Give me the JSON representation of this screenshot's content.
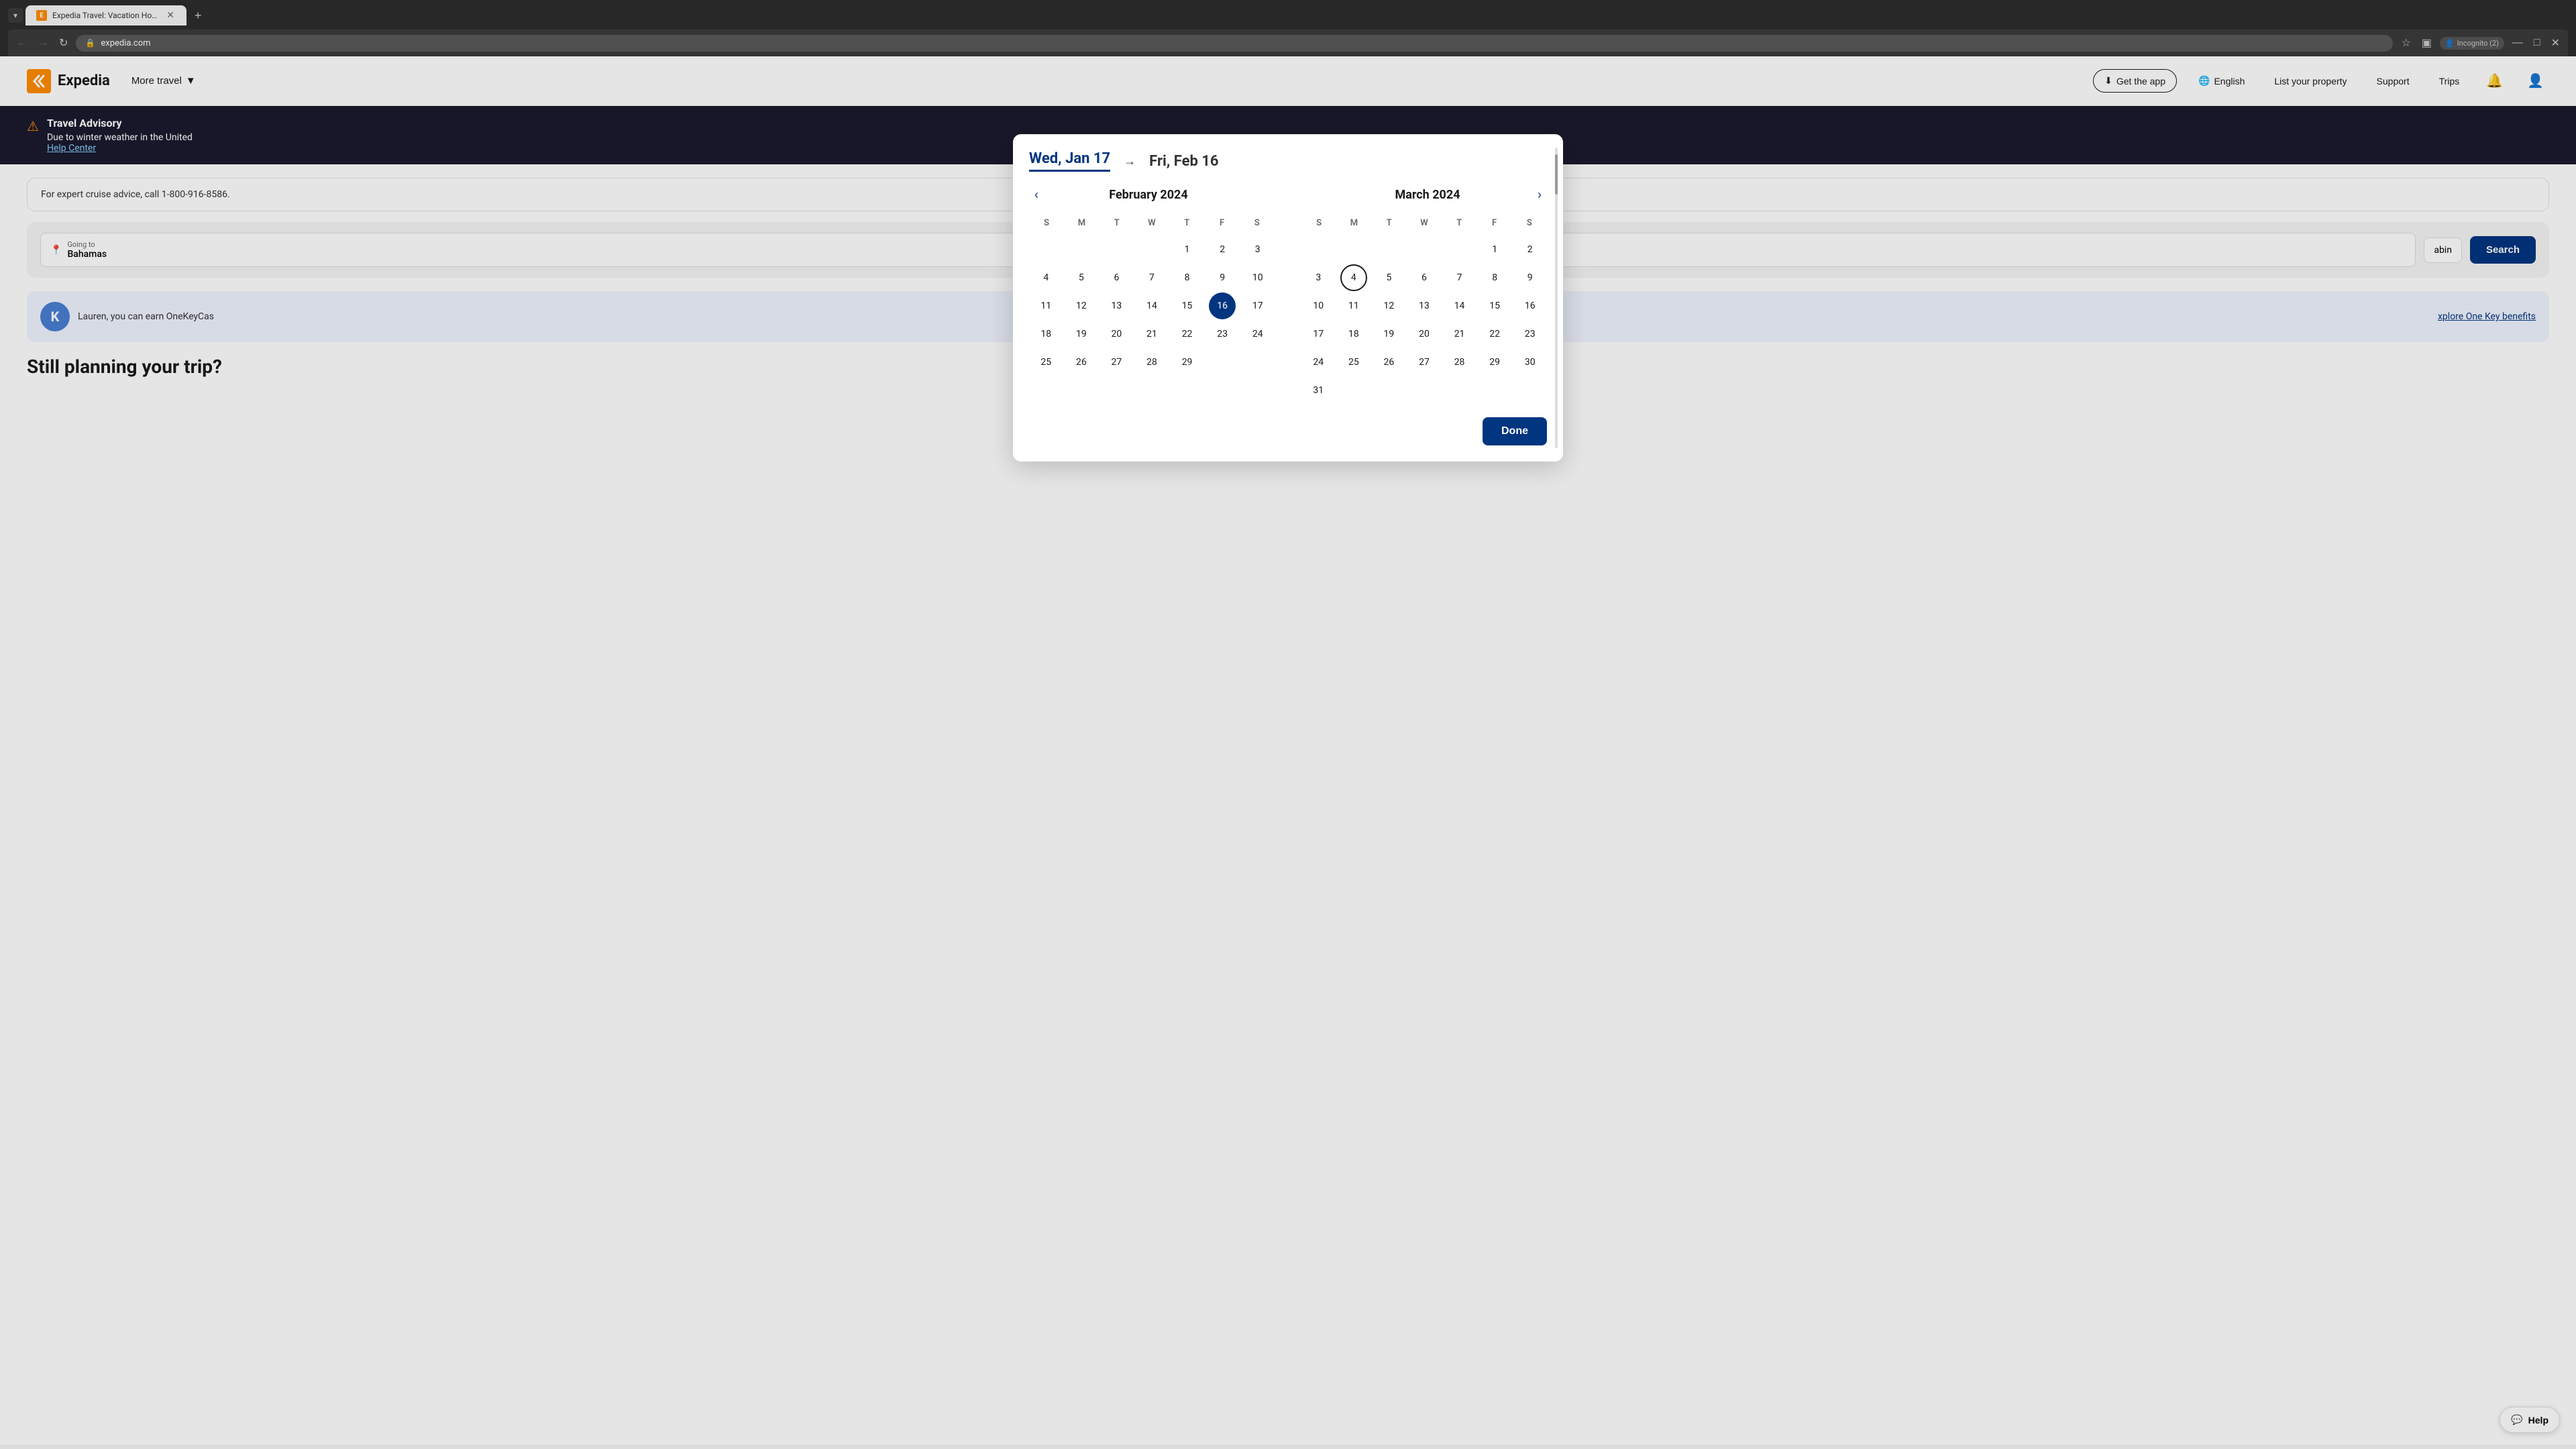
{
  "browser": {
    "tab_title": "Expedia Travel: Vacation Home...",
    "url": "expedia.com",
    "incognito_label": "Incognito (2)"
  },
  "header": {
    "logo_letter": "E",
    "logo_name": "Expedia",
    "more_travel": "More travel",
    "get_app": "Get the app",
    "language": "English",
    "list_property": "List your property",
    "support": "Support",
    "trips": "Trips"
  },
  "advisory": {
    "title": "Travel Advisory",
    "text": "Due to winter weather in the United",
    "link": "Help Center"
  },
  "cruise": {
    "text": "For expert cruise advice, call 1-800-916-8586."
  },
  "search": {
    "destination_label": "Going to",
    "destination_value": "Bahamas",
    "cabin_label": "abin",
    "button_label": "Search"
  },
  "onekey": {
    "avatar_letter": "K",
    "text": "Lauren, you can earn OneKeyCas",
    "link": "xplore One Key benefits"
  },
  "still_planning": {
    "heading": "Still planning your trip?"
  },
  "calendar": {
    "date_from": "Wed, Jan 17",
    "date_to": "Fri, Feb 16",
    "feb_title": "February 2024",
    "mar_title": "March 2024",
    "day_headers": [
      "S",
      "M",
      "T",
      "W",
      "T",
      "F",
      "S"
    ],
    "feb_days": [
      {
        "day": "",
        "empty": true
      },
      {
        "day": "",
        "empty": true
      },
      {
        "day": "",
        "empty": true
      },
      {
        "day": "",
        "empty": true
      },
      {
        "day": "1",
        "empty": false
      },
      {
        "day": "2",
        "empty": false
      },
      {
        "day": "3",
        "empty": false
      },
      {
        "day": "4",
        "empty": false
      },
      {
        "day": "5",
        "empty": false
      },
      {
        "day": "6",
        "empty": false
      },
      {
        "day": "7",
        "empty": false
      },
      {
        "day": "8",
        "empty": false
      },
      {
        "day": "9",
        "empty": false
      },
      {
        "day": "10",
        "empty": false
      },
      {
        "day": "11",
        "empty": false
      },
      {
        "day": "12",
        "empty": false
      },
      {
        "day": "13",
        "empty": false
      },
      {
        "day": "14",
        "empty": false
      },
      {
        "day": "15",
        "empty": false
      },
      {
        "day": "16",
        "empty": false,
        "selected": true
      },
      {
        "day": "17",
        "empty": false
      },
      {
        "day": "18",
        "empty": false
      },
      {
        "day": "19",
        "empty": false
      },
      {
        "day": "20",
        "empty": false
      },
      {
        "day": "21",
        "empty": false
      },
      {
        "day": "22",
        "empty": false
      },
      {
        "day": "23",
        "empty": false
      },
      {
        "day": "24",
        "empty": false
      },
      {
        "day": "25",
        "empty": false
      },
      {
        "day": "26",
        "empty": false
      },
      {
        "day": "27",
        "empty": false
      },
      {
        "day": "28",
        "empty": false
      },
      {
        "day": "29",
        "empty": false
      }
    ],
    "mar_days": [
      {
        "day": "",
        "empty": true
      },
      {
        "day": "",
        "empty": true
      },
      {
        "day": "",
        "empty": true
      },
      {
        "day": "",
        "empty": true
      },
      {
        "day": "",
        "empty": true
      },
      {
        "day": "1",
        "empty": false
      },
      {
        "day": "2",
        "empty": false
      },
      {
        "day": "3",
        "empty": false
      },
      {
        "day": "4",
        "empty": false,
        "circled": true
      },
      {
        "day": "5",
        "empty": false
      },
      {
        "day": "6",
        "empty": false
      },
      {
        "day": "7",
        "empty": false
      },
      {
        "day": "8",
        "empty": false
      },
      {
        "day": "9",
        "empty": false
      },
      {
        "day": "10",
        "empty": false
      },
      {
        "day": "11",
        "empty": false
      },
      {
        "day": "12",
        "empty": false
      },
      {
        "day": "13",
        "empty": false
      },
      {
        "day": "14",
        "empty": false
      },
      {
        "day": "15",
        "empty": false
      },
      {
        "day": "16",
        "empty": false
      },
      {
        "day": "17",
        "empty": false
      },
      {
        "day": "18",
        "empty": false
      },
      {
        "day": "19",
        "empty": false
      },
      {
        "day": "20",
        "empty": false
      },
      {
        "day": "21",
        "empty": false
      },
      {
        "day": "22",
        "empty": false
      },
      {
        "day": "23",
        "empty": false
      },
      {
        "day": "24",
        "empty": false
      },
      {
        "day": "25",
        "empty": false
      },
      {
        "day": "26",
        "empty": false
      },
      {
        "day": "27",
        "empty": false
      },
      {
        "day": "28",
        "empty": false
      },
      {
        "day": "29",
        "empty": false
      },
      {
        "day": "30",
        "empty": false
      },
      {
        "day": "31",
        "empty": false
      }
    ],
    "done_label": "Done"
  },
  "help": {
    "label": "Help"
  }
}
